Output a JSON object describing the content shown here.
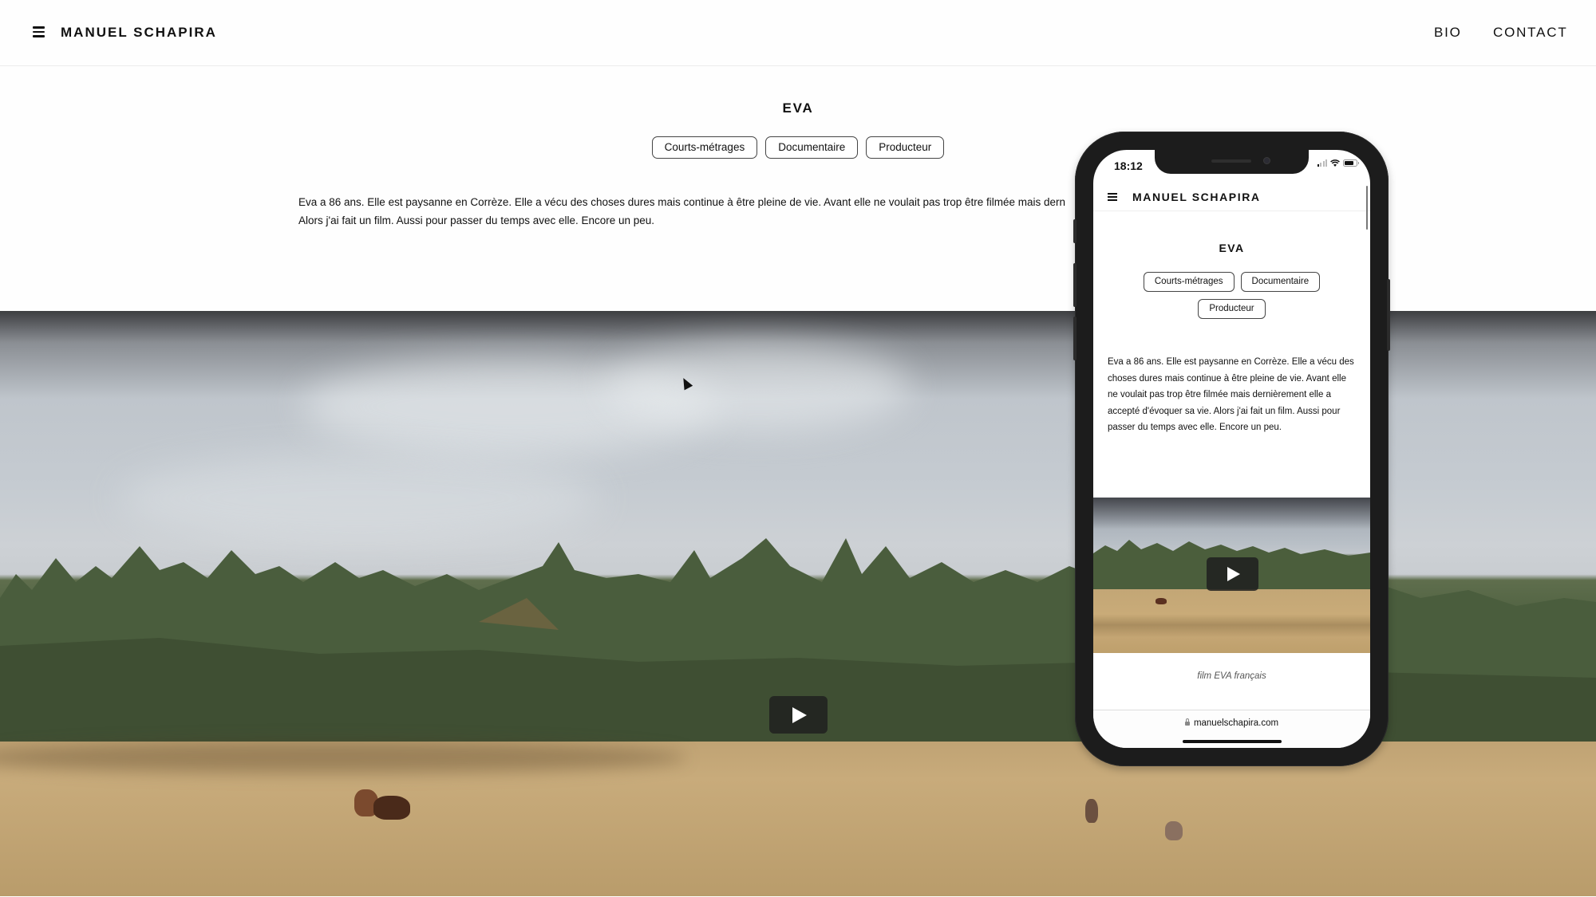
{
  "header": {
    "menu_icon": "hamburger-icon",
    "brand": "MANUEL SCHAPIRA",
    "nav": [
      {
        "label": "BIO"
      },
      {
        "label": "CONTACT"
      }
    ]
  },
  "project": {
    "title": "EVA",
    "tags": [
      {
        "label": "Courts-métrages"
      },
      {
        "label": "Documentaire"
      },
      {
        "label": "Producteur"
      }
    ],
    "description_desktop_line1": "Eva a 86 ans. Elle est paysanne en Corrèze. Elle a vécu des choses dures mais continue à être pleine de vie. Avant elle ne voulait pas trop être filmée mais dern",
    "description_desktop_line2": "Alors j'ai fait un film. Aussi pour passer du temps avec elle. Encore un peu.",
    "description": "Eva a 86 ans. Elle est paysanne en Corrèze. Elle a vécu des choses dures mais continue à être pleine de vie. Avant elle ne voulait pas trop être filmée mais dernièrement elle a accepté d'évoquer sa vie. Alors j'ai fait un film. Aussi pour passer du temps avec elle. Encore un peu.",
    "video": {
      "play_icon": "play-icon",
      "scene": "countryside field with trees and grazing cows"
    }
  },
  "phone": {
    "status_time": "18:12",
    "status_icons": [
      "signal-icon",
      "wifi-icon",
      "battery-icon"
    ],
    "brand": "MANUEL SCHAPIRA",
    "title": "EVA",
    "tags": [
      {
        "label": "Courts-métrages"
      },
      {
        "label": "Documentaire"
      },
      {
        "label": "Producteur"
      }
    ],
    "description": "Eva a 86 ans. Elle est paysanne en Corrèze. Elle a vécu des choses dures mais continue à être pleine de vie. Avant elle ne voulait pas trop être filmée mais dernièrement elle a accepté d'évoquer sa vie. Alors j'ai fait un film. Aussi pour passer du temps avec elle. Encore un peu.",
    "video_caption": "film EVA français",
    "url": "manuelschapira.com"
  },
  "colors": {
    "text": "#111111",
    "background": "#fefefe",
    "phone_frame": "#1c1c1c",
    "sky": "#c5cbd1",
    "field": "#c8ab7b",
    "trees": "#465a3a"
  }
}
